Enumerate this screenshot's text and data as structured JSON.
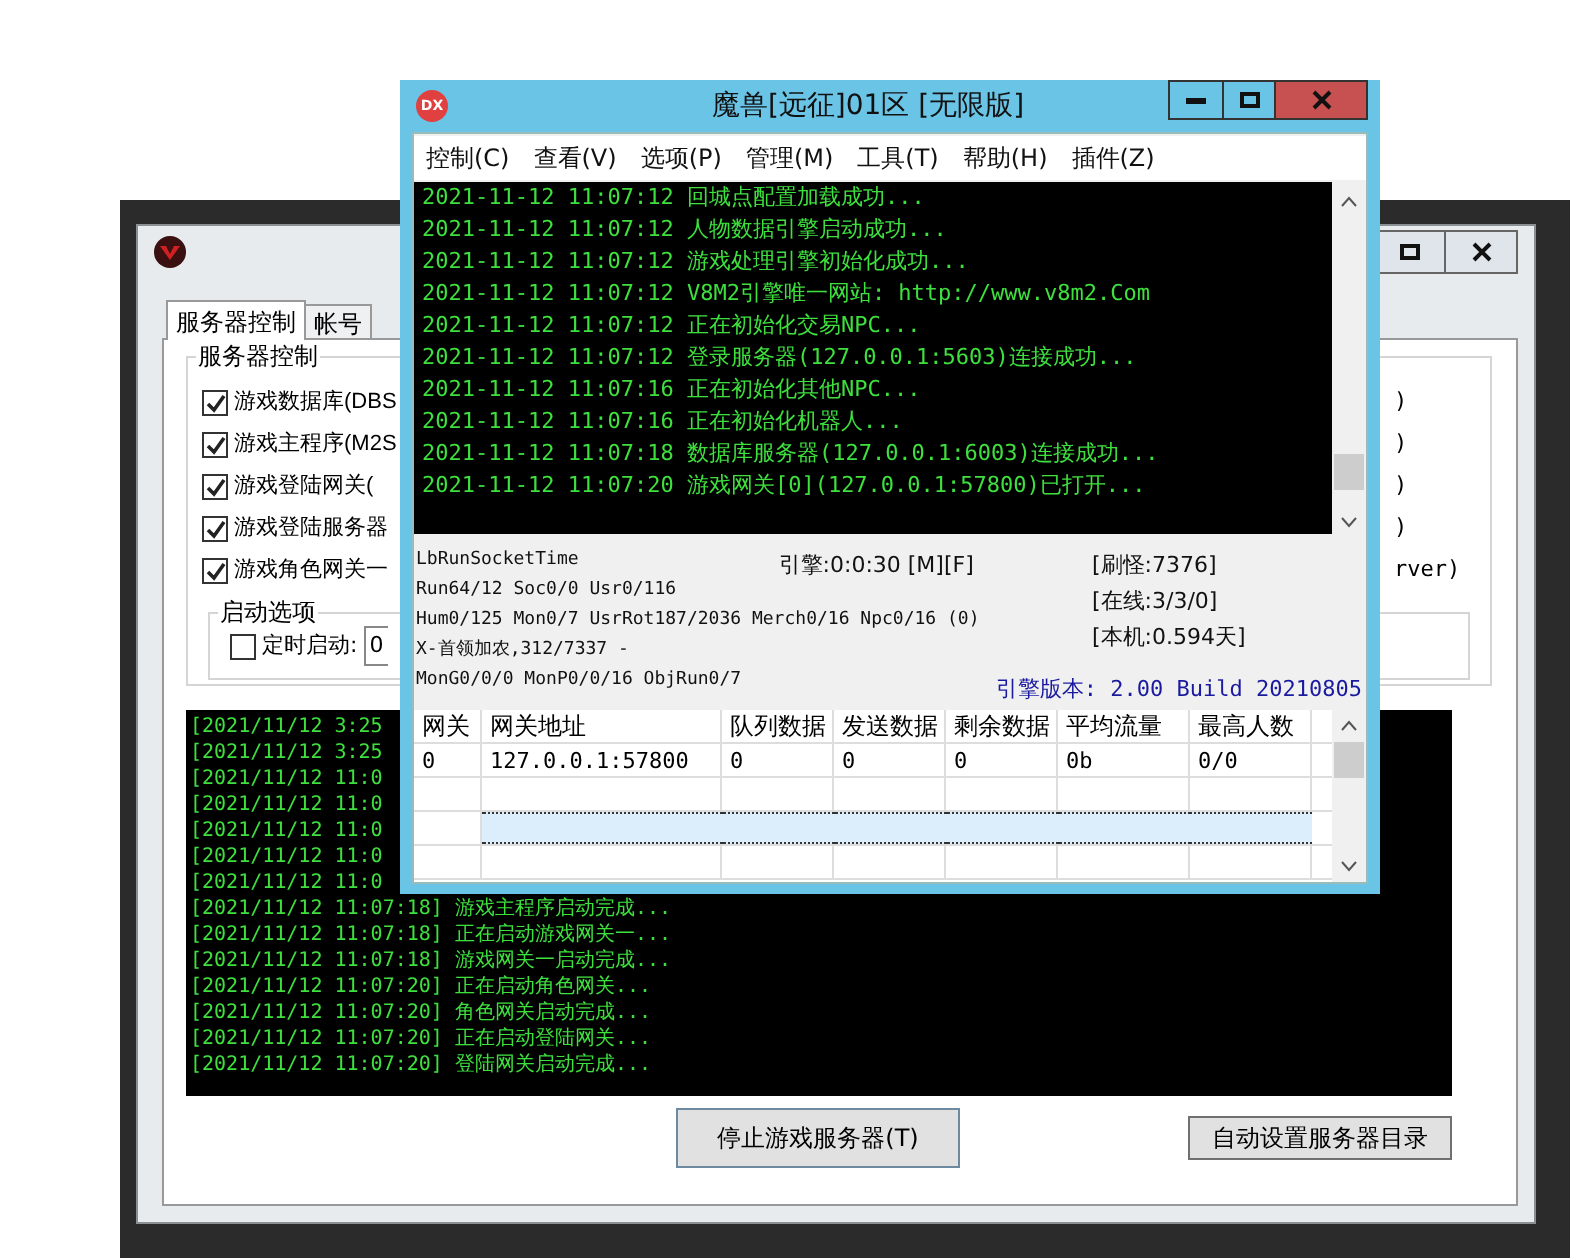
{
  "back_window": {
    "tabs": [
      {
        "label": "服务器控制",
        "selected": true
      },
      {
        "label": "帐号",
        "selected": false
      }
    ],
    "server_group": {
      "title": "服务器控制",
      "items": [
        {
          "label": "游戏数据库(DBS",
          "tail": ")",
          "checked": true
        },
        {
          "label": "游戏主程序(M2S",
          "tail": ")",
          "checked": true
        },
        {
          "label": "游戏登陆网关(",
          "tail": ")",
          "checked": true
        },
        {
          "label": "游戏登陆服务器",
          "tail": ")",
          "checked": true
        },
        {
          "label": "游戏角色网关一",
          "tail": "rver)",
          "checked": true
        }
      ]
    },
    "startup_group": {
      "title": "启动选项",
      "timer": {
        "label": "定时启动:",
        "checked": false,
        "value": "0"
      }
    },
    "log_lines": [
      "[2021/11/12 3:25",
      "[2021/11/12 3:25",
      "[2021/11/12 11:0",
      "[2021/11/12 11:0",
      "[2021/11/12 11:0",
      "[2021/11/12 11:0",
      "[2021/11/12 11:0",
      "[2021/11/12 11:07:18] 游戏主程序启动完成...",
      "[2021/11/12 11:07:18] 正在启动游戏网关一...",
      "[2021/11/12 11:07:18] 游戏网关一启动完成...",
      "[2021/11/12 11:07:20] 正在启动角色网关...",
      "[2021/11/12 11:07:20] 角色网关启动完成...",
      "[2021/11/12 11:07:20] 正在启动登陆网关...",
      "[2021/11/12 11:07:20] 登陆网关启动完成..."
    ],
    "buttons": [
      "停止游戏服务器(T)",
      "自动设置服务器目录"
    ]
  },
  "front_window": {
    "app_badge": "DX",
    "title": "魔兽[远征]01区 [无限版]",
    "menu": [
      "控制(C)",
      "查看(V)",
      "选项(P)",
      "管理(M)",
      "工具(T)",
      "帮助(H)",
      "插件(Z)"
    ],
    "log_lines": [
      "2021-11-12 11:07:12 回城点配置加载成功...",
      "2021-11-12 11:07:12 人物数据引擎启动成功...",
      "2021-11-12 11:07:12 游戏处理引擎初始化成功...",
      "2021-11-12 11:07:12 V8M2引擎唯一网站: http://www.v8m2.Com",
      "2021-11-12 11:07:12 正在初始化交易NPC...",
      "2021-11-12 11:07:12 登录服务器(127.0.0.1:5603)连接成功...",
      "2021-11-12 11:07:16 正在初始化其他NPC...",
      "2021-11-12 11:07:16 正在初始化机器人...",
      "2021-11-12 11:07:18 数据库服务器(127.0.0.1:6003)连接成功...",
      "2021-11-12 11:07:20 游戏网关[0](127.0.0.1:57800)已打开..."
    ],
    "status": {
      "left": [
        "LbRunSocketTime",
        "Run64/12 Soc0/0 Usr0/116",
        "Hum0/125 Mon0/7 UsrRot187/2036 Merch0/16 Npc0/16 (0)",
        "X-首领加农,312/7337 -",
        "MonG0/0/0 MonP0/0/16 ObjRun0/7"
      ],
      "engine": "引擎:0:0:30 [M][F]",
      "right": [
        "[刷怪:7376]",
        "[在线:3/3/0]",
        "[本机:0.594天]"
      ],
      "version": "引擎版本: 2.00 Build 20210805"
    },
    "grid": {
      "columns": [
        "网关",
        "网关地址",
        "队列数据",
        "发送数据",
        "剩余数据",
        "平均流量",
        "最高人数"
      ],
      "rows": [
        {
          "cells": [
            "0",
            "127.0.0.1:57800",
            "0",
            "0",
            "0",
            "0b",
            "0/0"
          ],
          "selected": false
        },
        {
          "selected": false
        },
        {
          "selected": true
        },
        {
          "selected": false
        }
      ]
    }
  }
}
